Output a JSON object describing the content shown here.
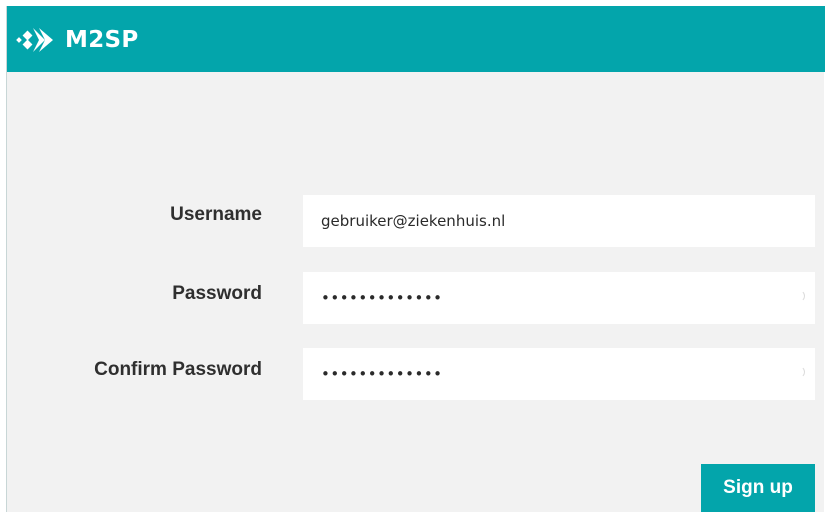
{
  "app": {
    "title": "M2SP",
    "logo_icon": "m2sp-logo-icon",
    "brand_color": "#03a5ab",
    "background_color": "#f2f2f2"
  },
  "form": {
    "username": {
      "label": "Username",
      "value": "gebruiker@ziekenhuis.nl"
    },
    "password": {
      "label": "Password",
      "value": "•••••••••••••"
    },
    "confirm_password": {
      "label": "Confirm Password",
      "value": "•••••••••••••"
    },
    "submit_label": "Sign up"
  }
}
